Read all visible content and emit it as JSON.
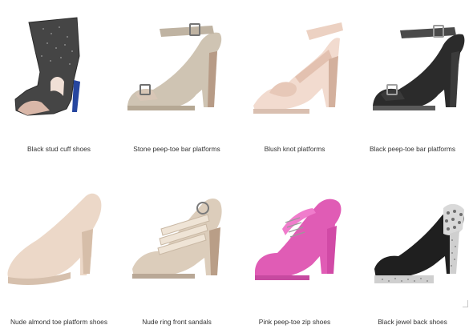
{
  "products": [
    {
      "name": "Black stud cuff shoes",
      "icon": "black-stud-cuff-shoe-image",
      "color": "#3a3a3a"
    },
    {
      "name": "Stone peep-toe bar platforms",
      "icon": "stone-peep-toe-platform-image",
      "color": "#c9bca8"
    },
    {
      "name": "Blush knot platforms",
      "icon": "blush-knot-platform-image",
      "color": "#ecd2c2"
    },
    {
      "name": "Black peep-toe bar platforms",
      "icon": "black-peep-toe-platform-image",
      "color": "#2b2b2b"
    },
    {
      "name": "Nude almond toe platform shoes",
      "icon": "nude-almond-toe-shoe-image",
      "color": "#ead7c8"
    },
    {
      "name": "Nude ring front sandals",
      "icon": "nude-ring-front-sandal-image",
      "color": "#d9cbb8"
    },
    {
      "name": "Pink peep-toe zip shoes",
      "icon": "pink-peep-toe-zip-shoe-image",
      "color": "#e05cb5"
    },
    {
      "name": "Black jewel back shoes",
      "icon": "black-jewel-back-shoe-image",
      "color": "#1f1f1f"
    }
  ]
}
